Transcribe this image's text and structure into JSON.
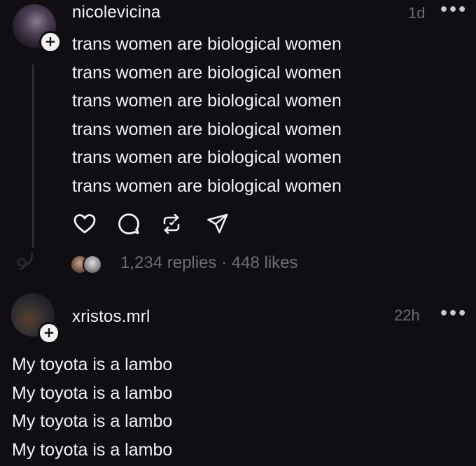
{
  "post1": {
    "username": "nicolevicina",
    "time": "1d",
    "more_label": "•••",
    "lines": [
      "trans women are biological women",
      "trans women are biological women",
      "trans women are biological women",
      "trans women are biological women",
      "trans women are biological women",
      "trans women are biological women"
    ],
    "stats": {
      "replies": "1,234 replies",
      "separator": "·",
      "likes": "448 likes"
    },
    "actions": [
      "heart-icon",
      "comment-icon",
      "repost-icon",
      "share-icon"
    ]
  },
  "post2": {
    "username": "xristos.mrl",
    "time": "22h",
    "more_label": "•••",
    "lines": [
      "My toyota is a lambo",
      "My toyota is a lambo",
      "My toyota is a lambo",
      "My toyota is a lambo"
    ]
  },
  "follow_badge": "+",
  "colors": {
    "background": "#100e13",
    "text": "#f3f3f5",
    "muted": "#6f6c74",
    "thread_line": "#2e2b33"
  }
}
